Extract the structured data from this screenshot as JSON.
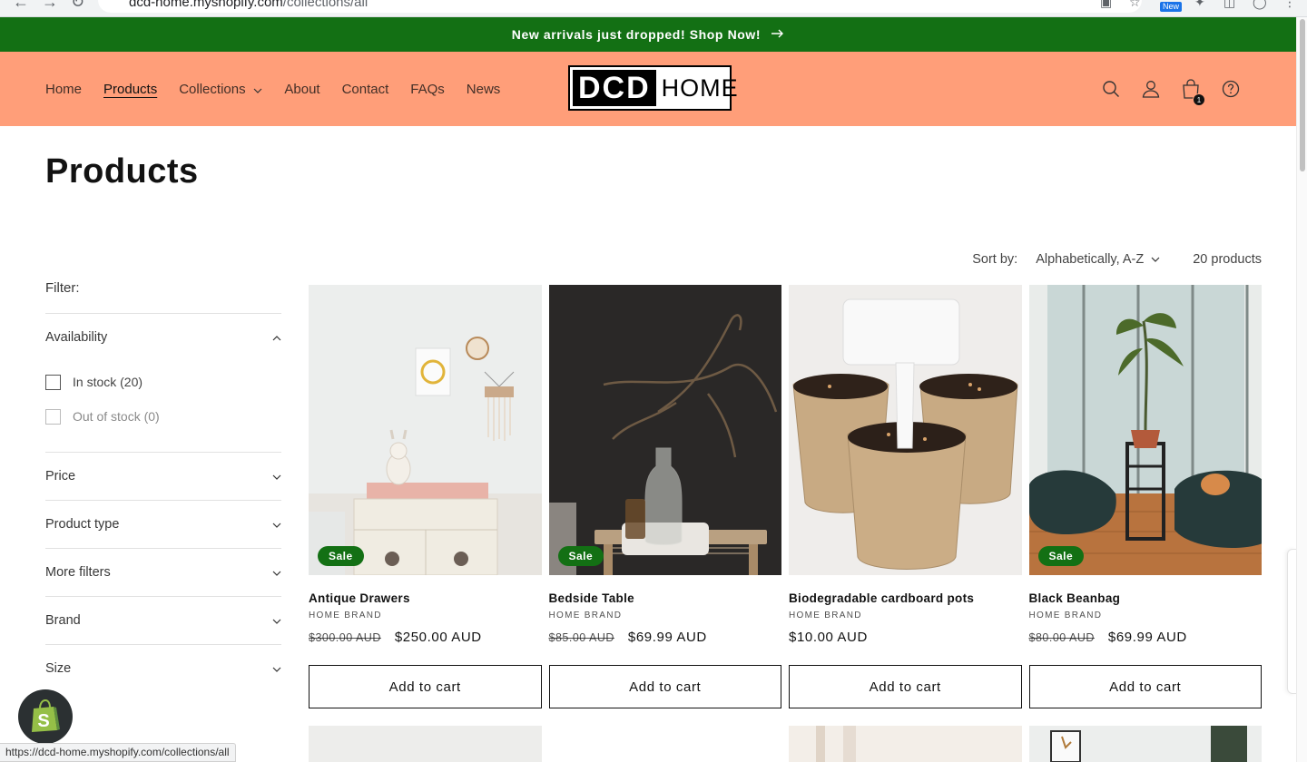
{
  "browser": {
    "url_host": "dcd-home.myshopify.com",
    "url_path": "/collections/all",
    "new_badge": "New"
  },
  "announcement": {
    "text": "New arrivals just dropped! Shop Now!",
    "arrow_icon": "arrow-right-icon"
  },
  "header": {
    "nav": [
      {
        "label": "Home",
        "active": false
      },
      {
        "label": "Products",
        "active": true
      },
      {
        "label": "Collections",
        "active": false,
        "has_dropdown": true
      },
      {
        "label": "About",
        "active": false
      },
      {
        "label": "Contact",
        "active": false
      },
      {
        "label": "FAQs",
        "active": false
      },
      {
        "label": "News",
        "active": false
      }
    ],
    "logo": {
      "dark": "DCD",
      "light": "HOME"
    },
    "cart_count": "1",
    "icons": [
      "search-icon",
      "account-icon",
      "cart-icon",
      "help-icon"
    ]
  },
  "page": {
    "title": "Products"
  },
  "filters": {
    "label": "Filter:",
    "facets": [
      {
        "label": "Availability",
        "expanded": true,
        "options": [
          {
            "label": "In stock (20)",
            "disabled": false
          },
          {
            "label": "Out of stock (0)",
            "disabled": true
          }
        ]
      },
      {
        "label": "Price",
        "expanded": false
      },
      {
        "label": "Product type",
        "expanded": false
      },
      {
        "label": "More filters",
        "expanded": false
      },
      {
        "label": "Brand",
        "expanded": false
      },
      {
        "label": "Size",
        "expanded": false
      }
    ]
  },
  "sort": {
    "label": "Sort by:",
    "selected": "Alphabetically, A-Z",
    "product_count": "20 products"
  },
  "products": [
    {
      "title": "Antique Drawers",
      "vendor": "HOME BRAND",
      "compare_price": "$300.00 AUD",
      "price": "$250.00 AUD",
      "sale": true,
      "sale_label": "Sale",
      "button": "Add to cart"
    },
    {
      "title": "Bedside Table",
      "vendor": "HOME BRAND",
      "compare_price": "$85.00 AUD",
      "price": "$69.99 AUD",
      "sale": true,
      "sale_label": "Sale",
      "button": "Add to cart"
    },
    {
      "title": "Biodegradable cardboard pots",
      "vendor": "HOME BRAND",
      "compare_price": "",
      "price": "$10.00 AUD",
      "sale": false,
      "sale_label": "",
      "button": "Add to cart"
    },
    {
      "title": "Black Beanbag",
      "vendor": "HOME BRAND",
      "compare_price": "$80.00 AUD",
      "price": "$69.99 AUD",
      "sale": true,
      "sale_label": "Sale",
      "button": "Add to cart"
    }
  ],
  "status_bar": {
    "url": "https://dcd-home.myshopify.com/collections/all"
  },
  "colors": {
    "announcement_bg": "#137014",
    "header_bg": "#ff9e79",
    "sale_badge_bg": "#137014",
    "text": "#121212"
  }
}
